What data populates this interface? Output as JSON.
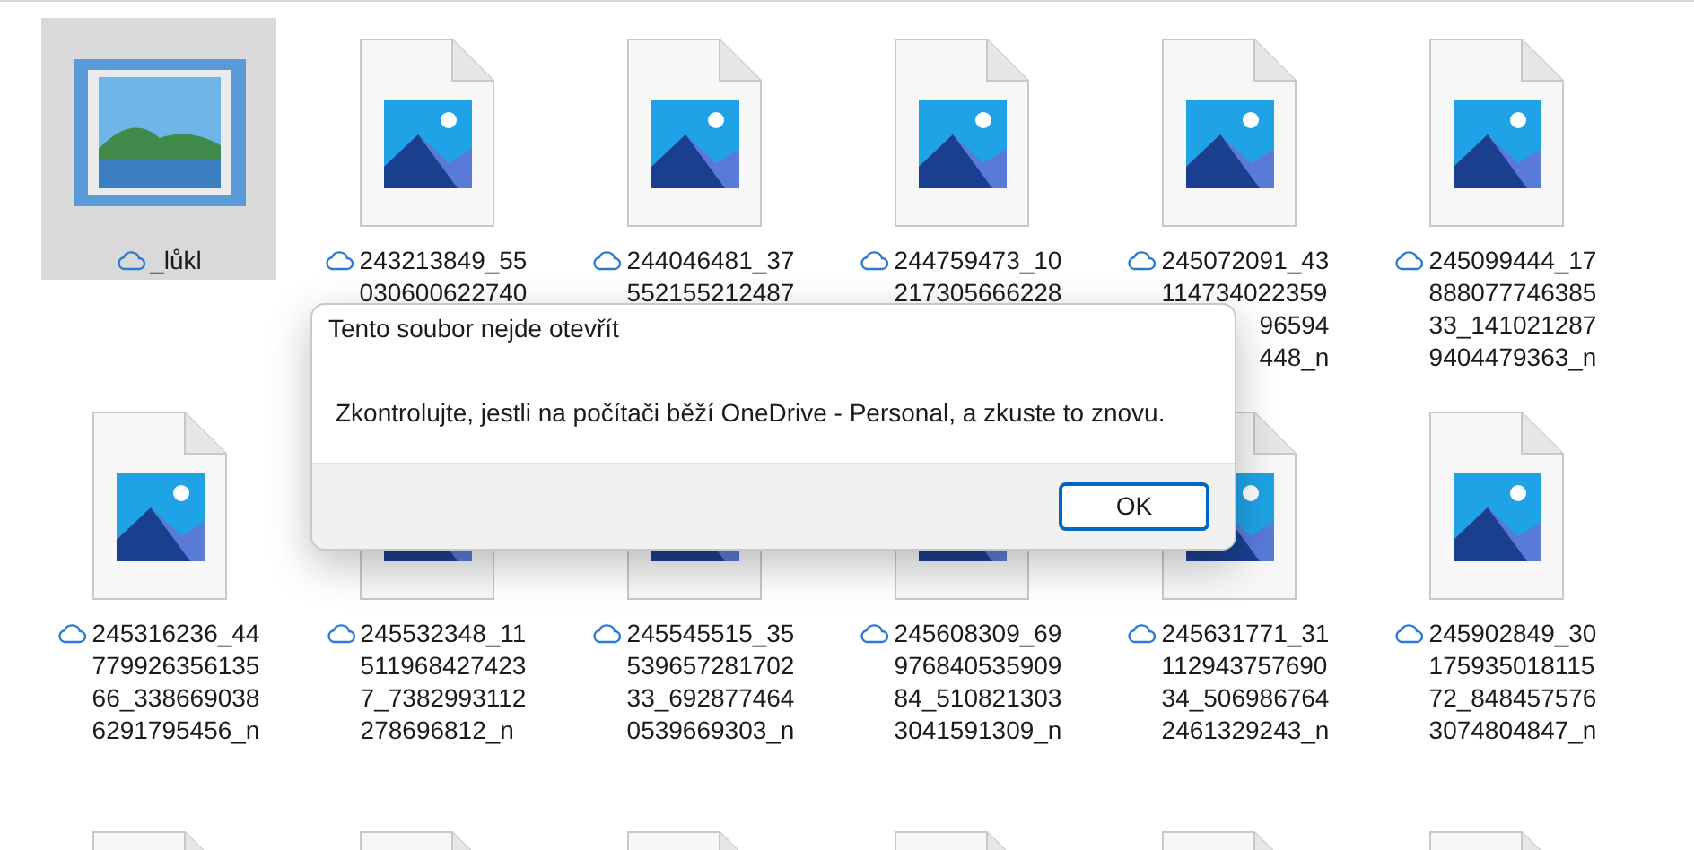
{
  "rows": [
    {
      "tiles": [
        {
          "kind": "app",
          "selected": true,
          "online_only": true,
          "label_lines": [
            {
              "text": "_lůkl",
              "kind": "full"
            }
          ]
        },
        {
          "kind": "image",
          "selected": false,
          "online_only": true,
          "label_lines": [
            {
              "text": "243213849_55",
              "kind": "full"
            },
            {
              "text": "030600622740",
              "kind": "full"
            }
          ]
        },
        {
          "kind": "image",
          "selected": false,
          "online_only": true,
          "label_lines": [
            {
              "text": "244046481_37",
              "kind": "full"
            },
            {
              "text": "552155212487",
              "kind": "full"
            }
          ]
        },
        {
          "kind": "image",
          "selected": false,
          "online_only": true,
          "label_lines": [
            {
              "text": "244759473_10",
              "kind": "full"
            },
            {
              "text": "217305666228",
              "kind": "full"
            }
          ]
        },
        {
          "kind": "image",
          "selected": false,
          "online_only": true,
          "label_lines": [
            {
              "text": "245072091_43",
              "kind": "full"
            },
            {
              "text": "114734022359",
              "kind": "full"
            },
            {
              "text": "96594",
              "kind": "tail"
            },
            {
              "text": "448_n",
              "kind": "tail"
            }
          ]
        },
        {
          "kind": "image",
          "selected": false,
          "online_only": true,
          "label_lines": [
            {
              "text": "245099444_17",
              "kind": "full"
            },
            {
              "text": "888077746385",
              "kind": "full"
            },
            {
              "text": "33_141021287",
              "kind": "full"
            },
            {
              "text": "9404479363_n",
              "kind": "full"
            }
          ]
        }
      ]
    },
    {
      "tiles": [
        {
          "kind": "image",
          "selected": false,
          "online_only": true,
          "label_lines": [
            {
              "text": "245316236_44",
              "kind": "full"
            },
            {
              "text": "779926356135",
              "kind": "full"
            },
            {
              "text": "66_338669038",
              "kind": "full"
            },
            {
              "text": "6291795456_n",
              "kind": "full"
            }
          ]
        },
        {
          "kind": "image",
          "selected": false,
          "online_only": true,
          "label_lines": [
            {
              "text": "245532348_11",
              "kind": "full"
            },
            {
              "text": "511968427423",
              "kind": "full"
            },
            {
              "text": "7_7382993112",
              "kind": "full"
            },
            {
              "text": "278696812_n",
              "kind": "full"
            }
          ]
        },
        {
          "kind": "image",
          "selected": false,
          "online_only": true,
          "label_lines": [
            {
              "text": "245545515_35",
              "kind": "full"
            },
            {
              "text": "539657281702",
              "kind": "full"
            },
            {
              "text": "33_692877464",
              "kind": "full"
            },
            {
              "text": "0539669303_n",
              "kind": "full"
            }
          ]
        },
        {
          "kind": "image",
          "selected": false,
          "online_only": true,
          "label_lines": [
            {
              "text": "245608309_69",
              "kind": "full"
            },
            {
              "text": "976840535909",
              "kind": "full"
            },
            {
              "text": "84_510821303",
              "kind": "full"
            },
            {
              "text": "3041591309_n",
              "kind": "full"
            }
          ]
        },
        {
          "kind": "image",
          "selected": false,
          "online_only": true,
          "label_lines": [
            {
              "text": "245631771_31",
              "kind": "full"
            },
            {
              "text": "112943757690",
              "kind": "full"
            },
            {
              "text": "34_506986764",
              "kind": "full"
            },
            {
              "text": "2461329243_n",
              "kind": "full"
            }
          ]
        },
        {
          "kind": "image",
          "selected": false,
          "online_only": true,
          "label_lines": [
            {
              "text": "245902849_30",
              "kind": "full"
            },
            {
              "text": "175935018115",
              "kind": "full"
            },
            {
              "text": "72_848457576",
              "kind": "full"
            },
            {
              "text": "3074804847_n",
              "kind": "full"
            }
          ]
        }
      ]
    },
    {
      "tiles": [
        {
          "kind": "image",
          "selected": false
        },
        {
          "kind": "image",
          "selected": false
        },
        {
          "kind": "image",
          "selected": false
        },
        {
          "kind": "image",
          "selected": false
        },
        {
          "kind": "image",
          "selected": false
        },
        {
          "kind": "image",
          "selected": false
        }
      ]
    }
  ],
  "dialog": {
    "title": "Tento soubor nejde otevřít",
    "message": "Zkontrolujte, jestli na počítači běží OneDrive - Personal, a zkuste to znovu.",
    "buttons": [
      "OK"
    ]
  }
}
